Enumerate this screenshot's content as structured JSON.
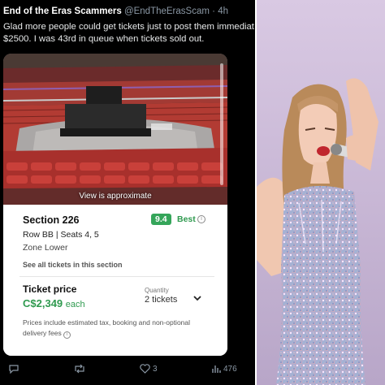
{
  "tweet": {
    "author": "End of the Eras Scammers",
    "handle": "@EndTheErasScam",
    "separator": "·",
    "time": "4h",
    "text_line1": "Glad more people could get tickets just to post them immediat",
    "text_line2": "$2500. I was 43rd in queue when tickets sold out."
  },
  "listing": {
    "view_note": "View is approximate",
    "section": "Section 226",
    "score": "9.4",
    "score_label": "Best",
    "row_seats": "Row BB | Seats 4, 5",
    "zone": "Zone Lower",
    "see_all": "See all tickets in this section",
    "price_label": "Ticket price",
    "price": "C$2,349",
    "price_unit": "each",
    "quantity_label": "Quantity",
    "quantity": "2 tickets",
    "disclaimer": "Prices include estimated tax, booking and non-optional delivery fees"
  },
  "actions": {
    "likes": "3",
    "views": "476"
  },
  "colors": {
    "accent_green": "#2f9a4f",
    "score_bg": "#35a55a",
    "seat_red": "#c0392b"
  }
}
